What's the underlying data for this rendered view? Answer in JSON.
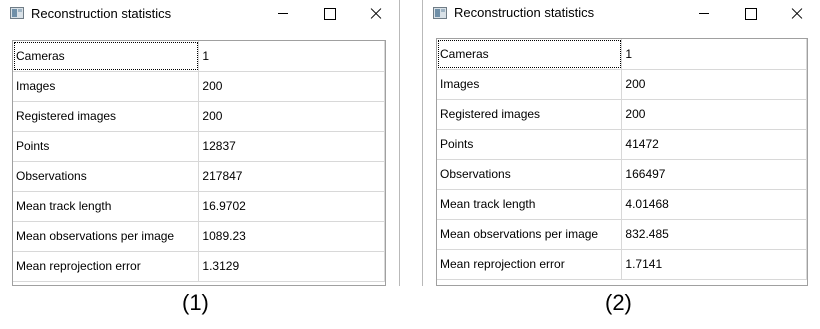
{
  "windows": [
    {
      "title": "Reconstruction statistics",
      "caption": "(1)",
      "rows": [
        {
          "label": "Cameras",
          "value": "1"
        },
        {
          "label": "Images",
          "value": "200"
        },
        {
          "label": "Registered images",
          "value": "200"
        },
        {
          "label": "Points",
          "value": "12837"
        },
        {
          "label": "Observations",
          "value": "217847"
        },
        {
          "label": "Mean track length",
          "value": "16.9702"
        },
        {
          "label": "Mean observations per image",
          "value": "1089.23"
        },
        {
          "label": "Mean reprojection error",
          "value": "1.3129"
        }
      ]
    },
    {
      "title": "Reconstruction statistics",
      "caption": "(2)",
      "rows": [
        {
          "label": "Cameras",
          "value": "1"
        },
        {
          "label": "Images",
          "value": "200"
        },
        {
          "label": "Registered images",
          "value": "200"
        },
        {
          "label": "Points",
          "value": "41472"
        },
        {
          "label": "Observations",
          "value": "166497"
        },
        {
          "label": "Mean track length",
          "value": "4.01468"
        },
        {
          "label": "Mean observations per image",
          "value": "832.485"
        },
        {
          "label": "Mean reprojection error",
          "value": "1.7141"
        }
      ]
    }
  ],
  "icons": {
    "app": "app-window-icon",
    "minimize": "minimize-icon",
    "maximize": "maximize-icon",
    "close": "close-icon"
  }
}
